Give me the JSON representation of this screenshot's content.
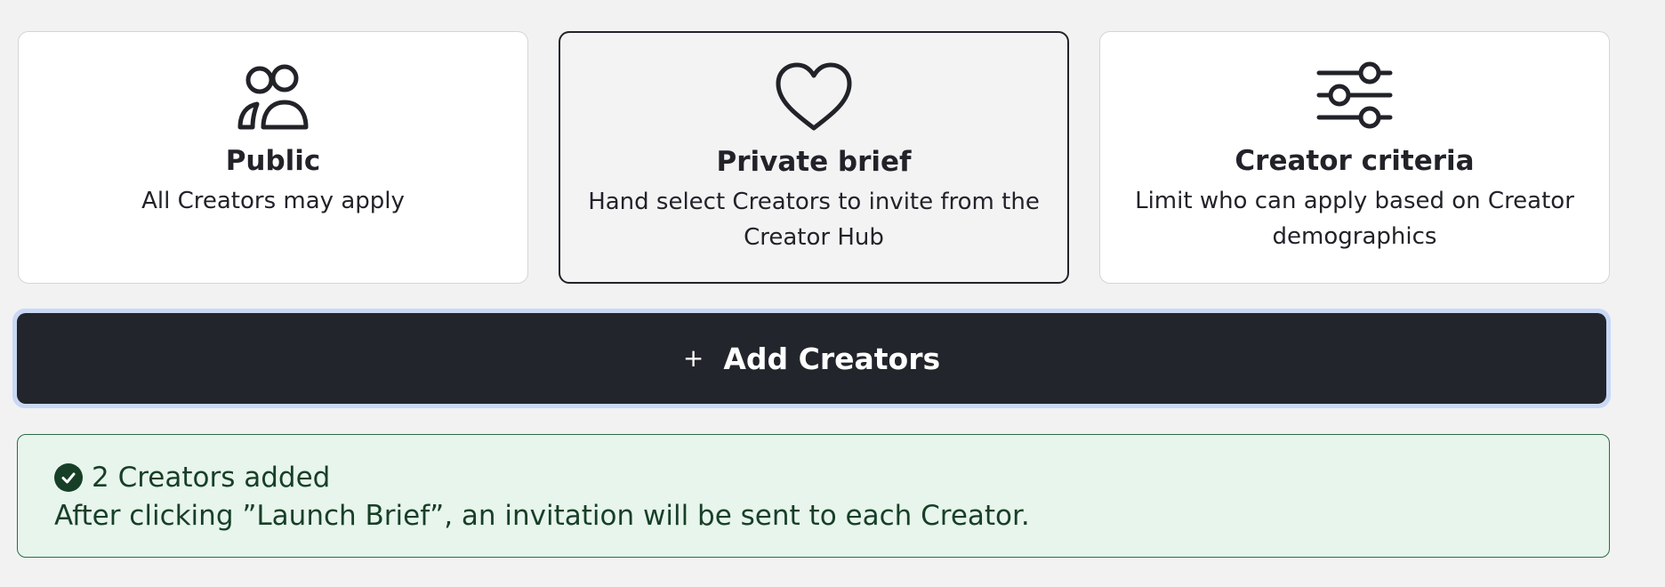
{
  "audience_options": [
    {
      "id": "public",
      "icon": "users-icon",
      "title": "Public",
      "description": "All Creators may apply",
      "selected": false
    },
    {
      "id": "private",
      "icon": "heart-icon",
      "title": "Private brief",
      "description": "Hand select Creators to invite from the Creator Hub",
      "selected": true
    },
    {
      "id": "criteria",
      "icon": "sliders-icon",
      "title": "Creator criteria",
      "description": "Limit who can apply based on Creator demographics",
      "selected": false
    }
  ],
  "add_button": {
    "icon": "plus-icon",
    "label": "Add Creators"
  },
  "notice": {
    "icon": "check-circle-icon",
    "title": "2 Creators added",
    "message": "After clicking ”Launch Brief”, an invitation will be sent to each Creator."
  },
  "colors": {
    "background": "#f2f2f3",
    "dark": "#22252b",
    "success_bg": "#e7f5ec",
    "success_border": "#2c6b45",
    "success_text": "#173f27",
    "focus_ring": "#c9d8f4"
  }
}
